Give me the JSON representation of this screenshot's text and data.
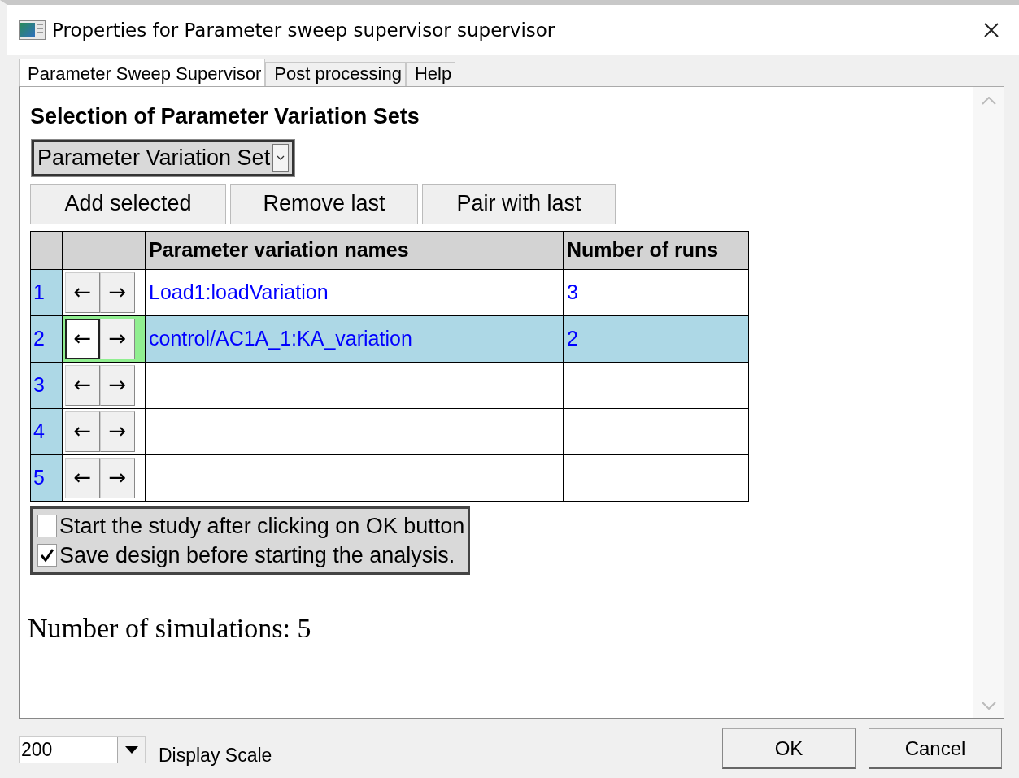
{
  "window": {
    "title": "Properties for Parameter sweep supervisor supervisor"
  },
  "tabs": [
    {
      "label": "Parameter Sweep Supervisor",
      "selected": true
    },
    {
      "label": "Post processing",
      "selected": false
    },
    {
      "label": "Help",
      "selected": false
    }
  ],
  "heading": "Selection of Parameter Variation Sets",
  "set_dropdown": {
    "value": "Parameter Variation Set"
  },
  "actions": [
    "Add selected",
    "Remove last",
    "Pair with last"
  ],
  "table": {
    "columns": [
      "Parameter variation names",
      "Number of runs"
    ],
    "rows": [
      {
        "index": "1",
        "left": "←",
        "right": "→",
        "name": "Load1:loadVariation",
        "runs": "3",
        "selected": false
      },
      {
        "index": "2",
        "left": "←",
        "right": "→",
        "name": "control/AC1A_1:KA_variation",
        "runs": "2",
        "selected": true
      },
      {
        "index": "3",
        "left": "←",
        "right": "→",
        "selected": false
      },
      {
        "index": "4",
        "left": "←",
        "right": "→",
        "selected": false
      },
      {
        "index": "5",
        "left": "←",
        "right": "→",
        "selected": false
      }
    ]
  },
  "options": [
    {
      "label": "Start the study after clicking on OK button",
      "checked": false
    },
    {
      "label": "Save design before starting the analysis.",
      "checked": true
    }
  ],
  "summary": "Number of simulations: 5",
  "footer": {
    "scale_value": "200",
    "scale_label": "Display Scale",
    "buttons": [
      "OK",
      "Cancel"
    ]
  }
}
